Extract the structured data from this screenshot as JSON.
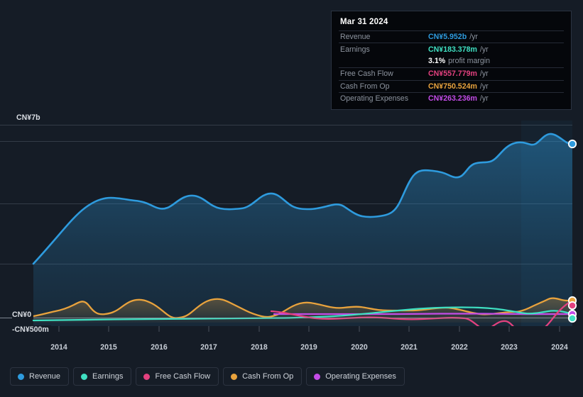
{
  "tooltip": {
    "date": "Mar 31 2024",
    "rows": [
      {
        "label": "Revenue",
        "value": "CN¥5.952b",
        "unit": "/yr",
        "color_key": "revenue"
      },
      {
        "label": "Earnings",
        "value": "CN¥183.378m",
        "unit": "/yr",
        "color_key": "earnings"
      },
      {
        "label": "",
        "value": "3.1%",
        "unit": "profit margin",
        "color_key": "white"
      },
      {
        "label": "Free Cash Flow",
        "value": "CN¥557.779m",
        "unit": "/yr",
        "color_key": "fcf"
      },
      {
        "label": "Cash From Op",
        "value": "CN¥750.524m",
        "unit": "/yr",
        "color_key": "cfo"
      },
      {
        "label": "Operating Expenses",
        "value": "CN¥263.236m",
        "unit": "/yr",
        "color_key": "opex"
      }
    ]
  },
  "axis": {
    "y_top_label": "CN¥7b",
    "y_zero_label": "CN¥0",
    "y_bottom_label": "-CN¥500m"
  },
  "legend": {
    "items": [
      {
        "label": "Revenue",
        "color": "#2e9bde"
      },
      {
        "label": "Earnings",
        "color": "#3fe0c2"
      },
      {
        "label": "Free Cash Flow",
        "color": "#e3417f"
      },
      {
        "label": "Cash From Op",
        "color": "#e9a33d"
      },
      {
        "label": "Operating Expenses",
        "color": "#c44ce8"
      }
    ]
  },
  "chart_data": {
    "type": "area",
    "title": "",
    "xlabel": "",
    "ylabel": "",
    "grid": true,
    "legend_position": "bottom",
    "currency": "CN¥",
    "ylim": [
      -500000000,
      7000000000
    ],
    "y_ticks": [
      {
        "value": 7000000000,
        "label": "CN¥7b"
      },
      {
        "value": 0,
        "label": "CN¥0"
      },
      {
        "value": -500000000,
        "label": "-CN¥500m"
      }
    ],
    "x_ticks": [
      "2014",
      "2015",
      "2016",
      "2017",
      "2018",
      "2019",
      "2020",
      "2021",
      "2022",
      "2023",
      "2024"
    ],
    "xlim": [
      "2013-06",
      "2024-03"
    ],
    "highlight_region": {
      "from": "2023-03",
      "to": "2024-03",
      "type": "last-year-shade"
    },
    "series": [
      {
        "name": "Revenue",
        "color": "#2e9bde",
        "unit": "CN¥",
        "last_value": 5952000000,
        "values": [
          1670,
          1840,
          2070,
          2340,
          2620,
          2880,
          3100,
          3290,
          3440,
          3530,
          3590,
          3650,
          3640,
          3620,
          3600,
          3560,
          3430,
          3430,
          3490,
          3610,
          3710,
          3610,
          3480,
          3440,
          3450,
          3480,
          3460,
          3430,
          3400,
          3420,
          3560,
          3700,
          3760,
          3700,
          3570,
          3460,
          3420,
          3420,
          3430,
          3440,
          3470,
          3600,
          3900,
          4250,
          4500,
          4600,
          4590,
          4530,
          4540,
          4690,
          4760,
          4760,
          5050,
          5350,
          5600,
          5680,
          5630,
          5700,
          5900,
          6050,
          5930,
          5840,
          5870,
          5952
        ]
      },
      {
        "name": "Earnings",
        "color": "#3fe0c2",
        "unit": "CN¥",
        "last_value": 183378000,
        "values": [
          40,
          42,
          44,
          46,
          48,
          50,
          52,
          54,
          56,
          58,
          60,
          62,
          64,
          66,
          66,
          66,
          64,
          62,
          62,
          64,
          66,
          66,
          64,
          62,
          62,
          64,
          66,
          68,
          70,
          72,
          74,
          76,
          78,
          78,
          76,
          74,
          72,
          72,
          74,
          78,
          84,
          92,
          100,
          112,
          126,
          142,
          158,
          172,
          186,
          200,
          212,
          220,
          224,
          224,
          218,
          208,
          196,
          184,
          176,
          176,
          182,
          196,
          200,
          183
        ]
      },
      {
        "name": "Free Cash Flow",
        "color": "#e3417f",
        "unit": "CN¥",
        "last_value": 557779000,
        "start_index": 30,
        "values": [
          null,
          null,
          null,
          null,
          null,
          null,
          null,
          null,
          null,
          null,
          null,
          null,
          null,
          null,
          null,
          null,
          null,
          null,
          null,
          null,
          null,
          null,
          null,
          null,
          null,
          null,
          null,
          null,
          null,
          null,
          320,
          280,
          230,
          180,
          140,
          110,
          90,
          80,
          78,
          80,
          90,
          100,
          110,
          120,
          120,
          110,
          95,
          78,
          62,
          50,
          30,
          -20,
          -90,
          -130,
          -90,
          -120,
          -230,
          -260,
          -250,
          -180,
          30,
          270,
          450,
          558
        ]
      },
      {
        "name": "Cash From Op",
        "color": "#e9a33d",
        "unit": "CN¥",
        "last_value": 750524000,
        "values": [
          40,
          60,
          80,
          110,
          150,
          200,
          260,
          310,
          340,
          330,
          300,
          290,
          300,
          330,
          380,
          440,
          500,
          540,
          540,
          500,
          440,
          380,
          300,
          200,
          110,
          60,
          60,
          110,
          200,
          300,
          400,
          480,
          540,
          590,
          640,
          660,
          620,
          560,
          500,
          470,
          470,
          490,
          540,
          580,
          580,
          540,
          480,
          430,
          400,
          390,
          400,
          430,
          430,
          380,
          300,
          230,
          190,
          180,
          200,
          260,
          390,
          520,
          650,
          751
        ]
      },
      {
        "name": "Operating Expenses",
        "color": "#c44ce8",
        "unit": "CN¥",
        "last_value": 263236000,
        "start_index": 31,
        "values": [
          null,
          null,
          null,
          null,
          null,
          null,
          null,
          null,
          null,
          null,
          null,
          null,
          null,
          null,
          null,
          null,
          null,
          null,
          null,
          null,
          null,
          null,
          null,
          null,
          null,
          null,
          null,
          null,
          null,
          null,
          null,
          250,
          252,
          254,
          256,
          258,
          258,
          256,
          254,
          252,
          250,
          250,
          252,
          254,
          256,
          256,
          254,
          252,
          250,
          248,
          248,
          250,
          252,
          254,
          256,
          256,
          254,
          250,
          246,
          244,
          246,
          252,
          258,
          263
        ]
      }
    ]
  }
}
